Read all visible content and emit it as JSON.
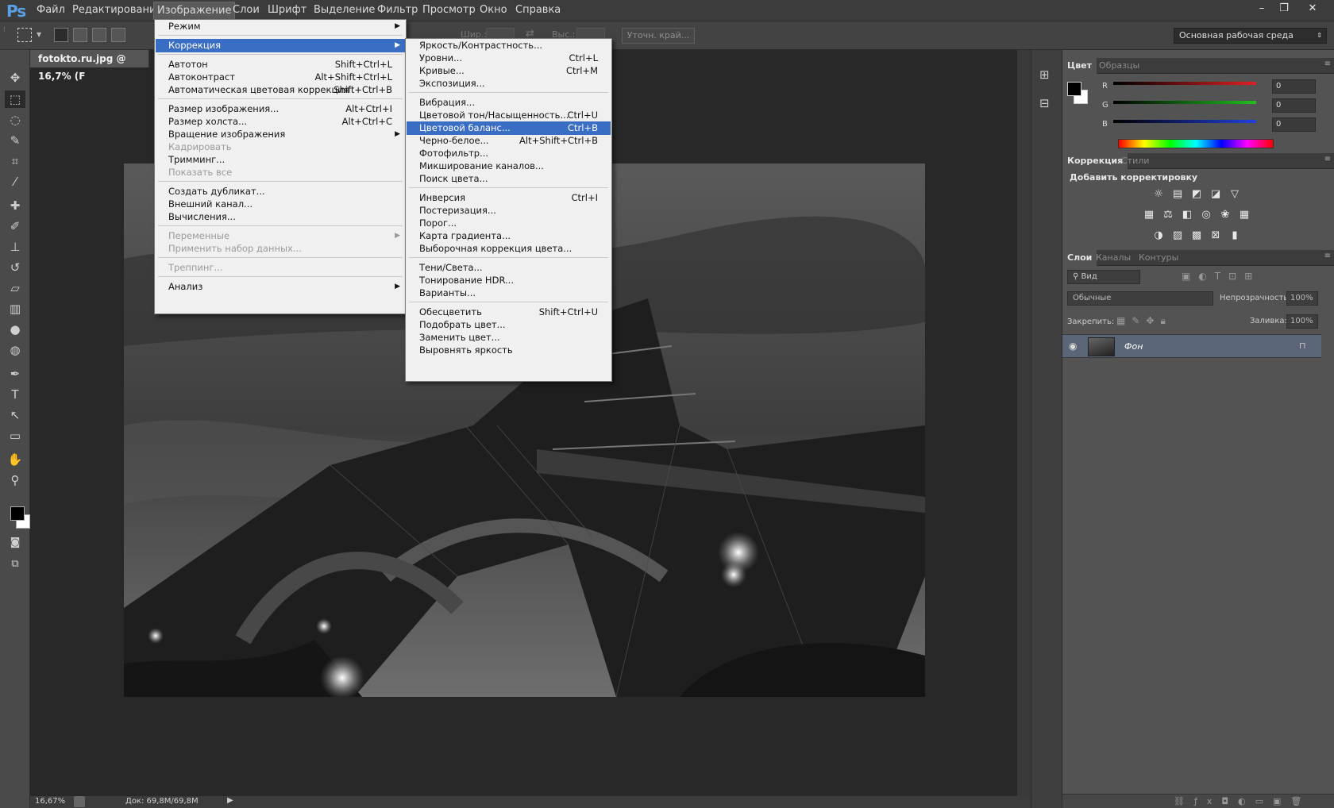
{
  "app": {
    "logo": "Ps"
  },
  "menubar": {
    "items": [
      "Файл",
      "Редактирование",
      "Изображение",
      "Слои",
      "Шрифт",
      "Выделение",
      "Фильтр",
      "Просмотр",
      "Окно",
      "Справка"
    ],
    "active": "Изображение"
  },
  "window_controls": {
    "minimize": "–",
    "restore": "❐",
    "close": "✕"
  },
  "options": {
    "refine_edge_label": "Уточн. край...",
    "width_label": "Шир.:",
    "height_label": "Выс.:",
    "workspace": "Основная рабочая среда"
  },
  "document": {
    "tab_title": "fotokto.ru.jpg @ 16,7% (F",
    "zoom": "16,67%",
    "doc_size": "Док: 69,8M/69,8M"
  },
  "image_menu": {
    "items": [
      {
        "label": "Режим",
        "shortcut": "",
        "submenu": true,
        "disabled": false
      },
      {
        "label": "Коррекция",
        "shortcut": "",
        "submenu": true,
        "disabled": false,
        "highlighted": true
      },
      {
        "label": "Автотон",
        "shortcut": "Shift+Ctrl+L"
      },
      {
        "label": "Автоконтраст",
        "shortcut": "Alt+Shift+Ctrl+L"
      },
      {
        "label": "Автоматическая цветовая коррекция",
        "shortcut": "Shift+Ctrl+B"
      },
      {
        "label": "Размер изображения...",
        "shortcut": "Alt+Ctrl+I"
      },
      {
        "label": "Размер холста...",
        "shortcut": "Alt+Ctrl+C"
      },
      {
        "label": "Вращение изображения",
        "shortcut": "",
        "submenu": true
      },
      {
        "label": "Кадрировать",
        "shortcut": "",
        "disabled": true
      },
      {
        "label": "Тримминг...",
        "shortcut": ""
      },
      {
        "label": "Показать все",
        "shortcut": "",
        "disabled": true
      },
      {
        "label": "Создать дубликат...",
        "shortcut": ""
      },
      {
        "label": "Внешний канал...",
        "shortcut": ""
      },
      {
        "label": "Вычисления...",
        "shortcut": ""
      },
      {
        "label": "Переменные",
        "shortcut": "",
        "submenu": true,
        "disabled": true
      },
      {
        "label": "Применить набор данных...",
        "shortcut": "",
        "disabled": true
      },
      {
        "label": "Треппинг...",
        "shortcut": "",
        "disabled": true
      },
      {
        "label": "Анализ",
        "shortcut": "",
        "submenu": true
      }
    ]
  },
  "correction_menu": {
    "items": [
      {
        "label": "Яркость/Контрастность...",
        "shortcut": ""
      },
      {
        "label": "Уровни...",
        "shortcut": "Ctrl+L"
      },
      {
        "label": "Кривые...",
        "shortcut": "Ctrl+M"
      },
      {
        "label": "Экспозиция...",
        "shortcut": ""
      },
      {
        "label": "Вибрация...",
        "shortcut": ""
      },
      {
        "label": "Цветовой тон/Насыщенность...",
        "shortcut": "Ctrl+U"
      },
      {
        "label": "Цветовой баланс...",
        "shortcut": "Ctrl+B",
        "highlighted": true
      },
      {
        "label": "Черно-белое...",
        "shortcut": "Alt+Shift+Ctrl+B"
      },
      {
        "label": "Фотофильтр...",
        "shortcut": ""
      },
      {
        "label": "Микширование каналов...",
        "shortcut": ""
      },
      {
        "label": "Поиск цвета...",
        "shortcut": ""
      },
      {
        "label": "Инверсия",
        "shortcut": "Ctrl+I"
      },
      {
        "label": "Постеризация...",
        "shortcut": ""
      },
      {
        "label": "Порог...",
        "shortcut": ""
      },
      {
        "label": "Карта градиента...",
        "shortcut": ""
      },
      {
        "label": "Выборочная коррекция цвета...",
        "shortcut": ""
      },
      {
        "label": "Тени/Света...",
        "shortcut": ""
      },
      {
        "label": "Тонирование HDR...",
        "shortcut": ""
      },
      {
        "label": "Варианты...",
        "shortcut": ""
      },
      {
        "label": "Обесцветить",
        "shortcut": "Shift+Ctrl+U"
      },
      {
        "label": "Подобрать цвет...",
        "shortcut": ""
      },
      {
        "label": "Заменить цвет...",
        "shortcut": ""
      },
      {
        "label": "Выровнять яркость",
        "shortcut": ""
      }
    ]
  },
  "color_panel": {
    "tabs": [
      "Цвет",
      "Образцы"
    ],
    "channels": [
      {
        "name": "R",
        "value": "0",
        "color": "#e02020"
      },
      {
        "name": "G",
        "value": "0",
        "color": "#20c020"
      },
      {
        "name": "B",
        "value": "0",
        "color": "#2040e0"
      }
    ]
  },
  "adjust_panel": {
    "tabs": [
      "Коррекция",
      "Стили"
    ],
    "title": "Добавить корректировку"
  },
  "layers_panel": {
    "tabs": [
      "Слои",
      "Каналы",
      "Контуры"
    ],
    "search_label": "Вид",
    "blend_mode": "Обычные",
    "opacity_label": "Непрозрачность:",
    "opacity_value": "100%",
    "lock_label": "Закрепить:",
    "fill_label": "Заливка:",
    "fill_value": "100%",
    "layers": [
      {
        "name": "Фон"
      }
    ]
  },
  "colors": {
    "accent": "#3a6ec4",
    "menu_bg": "#f0f0f0",
    "ui_dark": "#3c3c3c"
  }
}
